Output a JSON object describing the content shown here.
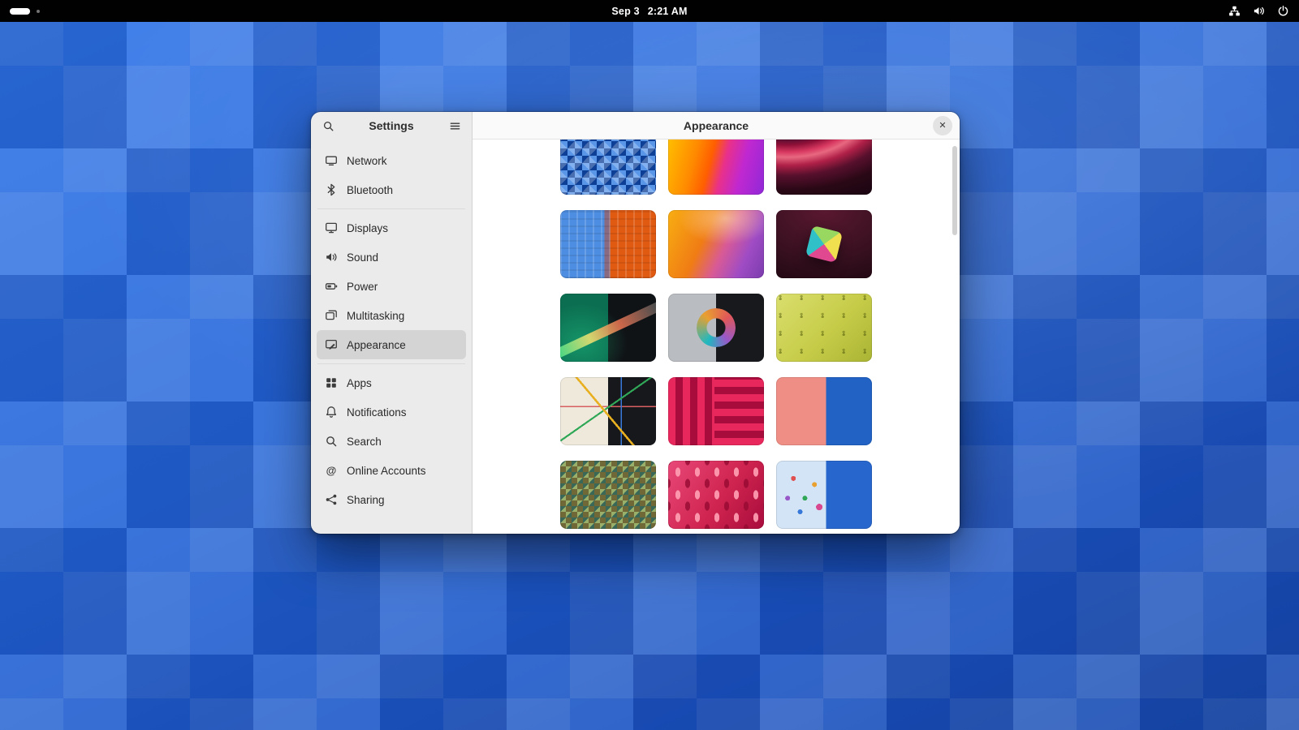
{
  "topbar": {
    "date": "Sep 3",
    "time": "2:21 AM",
    "status_icons": [
      "network",
      "volume",
      "power"
    ]
  },
  "settings_window": {
    "sidebar": {
      "title": "Settings",
      "items": [
        {
          "label": "Network",
          "icon": "network"
        },
        {
          "label": "Bluetooth",
          "icon": "bluetooth",
          "separator_after": true
        },
        {
          "label": "Displays",
          "icon": "displays"
        },
        {
          "label": "Sound",
          "icon": "sound"
        },
        {
          "label": "Power",
          "icon": "power"
        },
        {
          "label": "Multitasking",
          "icon": "multitasking"
        },
        {
          "label": "Appearance",
          "icon": "appearance",
          "selected": true,
          "separator_after": true
        },
        {
          "label": "Apps",
          "icon": "apps"
        },
        {
          "label": "Notifications",
          "icon": "notifications"
        },
        {
          "label": "Search",
          "icon": "search"
        },
        {
          "label": "Online Accounts",
          "icon": "online-accounts"
        },
        {
          "label": "Sharing",
          "icon": "sharing"
        }
      ]
    },
    "header": {
      "title": "Appearance",
      "close_glyph": "✕"
    },
    "wallpapers": [
      {
        "name": "blue-triangle-mosaic"
      },
      {
        "name": "orange-magenta-gradient"
      },
      {
        "name": "dark-red-waves"
      },
      {
        "name": "blue-orange-glitch"
      },
      {
        "name": "orange-purple-silk"
      },
      {
        "name": "color-cube"
      },
      {
        "name": "green-wave"
      },
      {
        "name": "gradient-ring"
      },
      {
        "name": "yellow-doodles"
      },
      {
        "name": "metro-map"
      },
      {
        "name": "red-stripes"
      },
      {
        "name": "salmon-blue-split"
      },
      {
        "name": "multicolor-mosaic"
      },
      {
        "name": "pink-capsules"
      },
      {
        "name": "confetti-blue-split"
      }
    ]
  },
  "colors": {
    "accent": "#3584e4",
    "topbar_bg": "#010101",
    "desktop_base": "#2263d6",
    "sidebar_bg": "#ebebeb",
    "sidebar_selected": "#d4d4d4"
  }
}
